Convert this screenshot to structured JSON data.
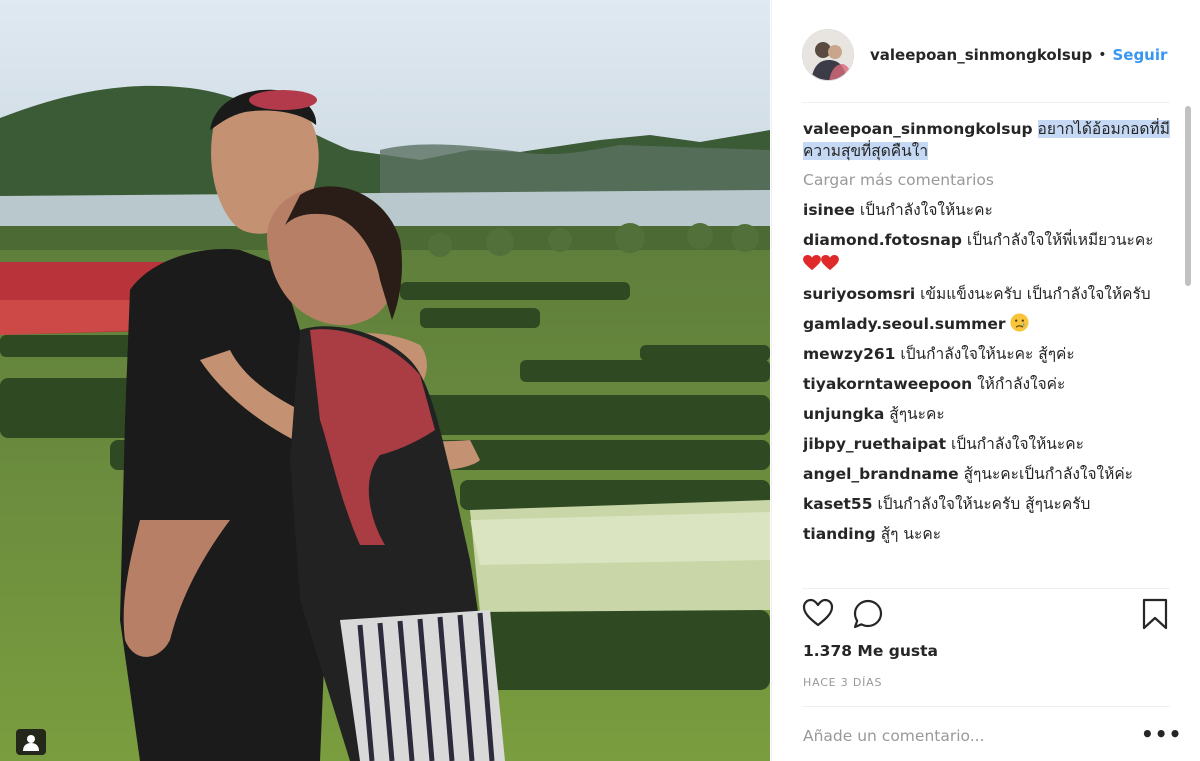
{
  "post": {
    "username": "valeepoan_sinmongkolsup",
    "separator": "•",
    "follow_label": "Seguir",
    "caption": {
      "username": "valeepoan_sinmongkolsup",
      "text": "อยากได้อ้อมกอดที่มีความสุขที่สุดคืนใา"
    },
    "load_more_label": "Cargar más comentarios",
    "comments": [
      {
        "user": "isinee",
        "text": "เป็นกำลังใจให้นะคะ"
      },
      {
        "user": "diamond.fotosnap",
        "text": "เป็นกำลังใจให้พี่เหมียวนะคะ",
        "emoji": "heart-heart"
      },
      {
        "user": "suriyosomsri",
        "text": "เข้มแข็งนะครับ เป็นกำลังใจให้ครับ"
      },
      {
        "user": "gamlady.seoul.summer",
        "text": "",
        "emoji": "crying-face"
      },
      {
        "user": "mewzy261",
        "text": "เป็นกำลังใจให้นะคะ สู้ๆค่ะ"
      },
      {
        "user": "tiyakorntaweepoon",
        "text": "ให้กำลังใจค่ะ"
      },
      {
        "user": "unjungka",
        "text": "สู้ๆนะคะ"
      },
      {
        "user": "jibpy_ruethaipat",
        "text": "เป็นกำลังใจให้นะคะ"
      },
      {
        "user": "angel_brandname",
        "text": "สู้ๆนะคะเป็นกำลังใจให้ค่ะ"
      },
      {
        "user": "kaset55",
        "text": "เป็นกำลังใจให้นะครับ สู้ๆนะครับ"
      },
      {
        "user": "tianding",
        "text": "สู้ๆ นะคะ"
      }
    ],
    "likes_label": "1.378 Me gusta",
    "time_ago": "HACE 3 DÍAS",
    "comment_placeholder": "Añade un comentario...",
    "more_label": "•••"
  },
  "icons": {
    "like": "heart-outline-icon",
    "comment": "speech-bubble-icon",
    "save": "bookmark-icon",
    "tagged": "person-tag-icon"
  },
  "colors": {
    "link": "#3897f0",
    "muted": "#999999",
    "text": "#262626",
    "highlight": "#c5d9f5",
    "heart_emoji": "#e02a2a"
  }
}
